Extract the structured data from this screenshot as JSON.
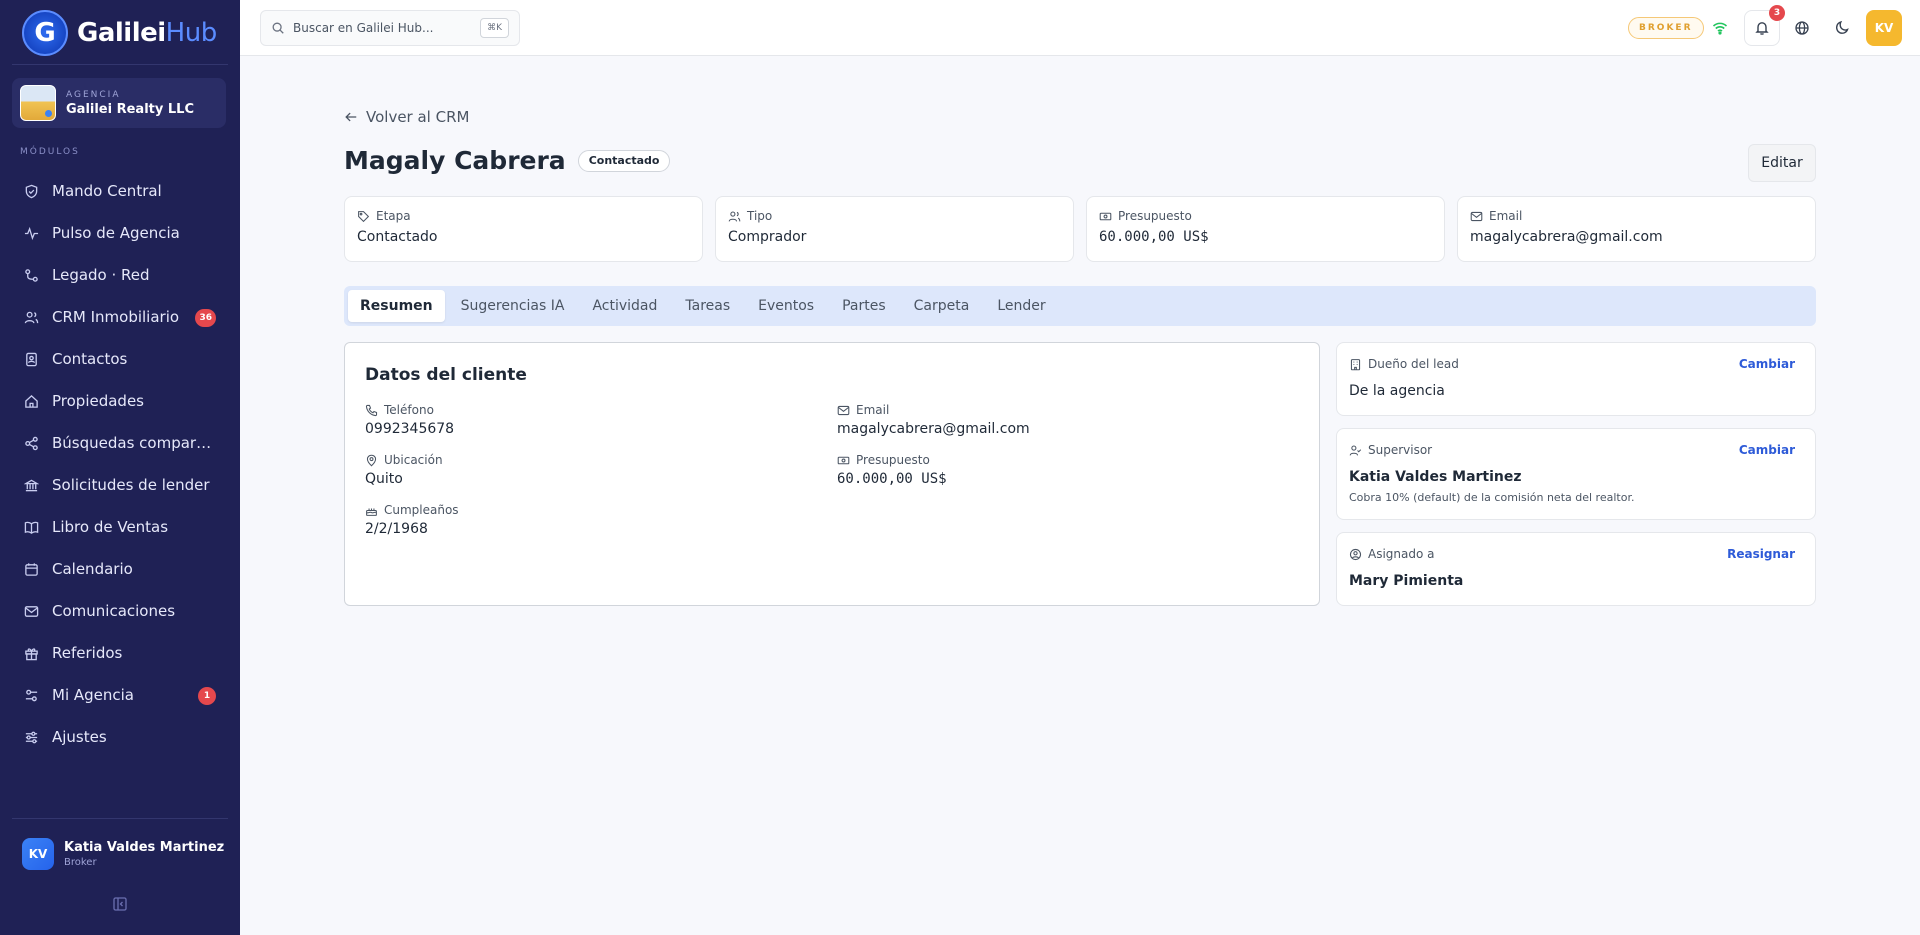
{
  "brand": {
    "name": "Galilei",
    "suffix": "Hub",
    "logo_letter": "G"
  },
  "agency": {
    "kicker": "AGENCIA",
    "name": "Galilei Realty LLC"
  },
  "sidebar": {
    "section_label": "MÓDULOS",
    "items": [
      {
        "label": "Mando Central",
        "icon": "shield-icon"
      },
      {
        "label": "Pulso de Agencia",
        "icon": "pulse-icon"
      },
      {
        "label": "Legado · Red",
        "icon": "network-icon"
      },
      {
        "label": "CRM Inmobiliario",
        "icon": "users-icon",
        "badge": "36"
      },
      {
        "label": "Contactos",
        "icon": "contacts-icon"
      },
      {
        "label": "Propiedades",
        "icon": "home-icon"
      },
      {
        "label": "Búsquedas compartidas",
        "icon": "share-icon"
      },
      {
        "label": "Solicitudes de lender",
        "icon": "bank-icon"
      },
      {
        "label": "Libro de Ventas",
        "icon": "book-icon"
      },
      {
        "label": "Calendario",
        "icon": "calendar-icon"
      },
      {
        "label": "Comunicaciones",
        "icon": "mail-icon"
      },
      {
        "label": "Referidos",
        "icon": "gift-icon"
      },
      {
        "label": "Mi Agencia",
        "icon": "settings-sliders-icon",
        "badge": "1"
      },
      {
        "label": "Ajustes",
        "icon": "sliders-icon"
      }
    ]
  },
  "user": {
    "initials": "KV",
    "name": "Katia Valdes Martinez",
    "role": "Broker"
  },
  "topbar": {
    "search_placeholder": "Buscar en Galilei Hub...",
    "search_shortcut": "⌘K",
    "role_pill": "BROKER",
    "notifications_count": "3",
    "avatar_initials": "KV"
  },
  "page": {
    "back_label": "Volver al CRM",
    "title": "Magaly Cabrera",
    "status": "Contactado",
    "edit_label": "Editar"
  },
  "stats": [
    {
      "label": "Etapa",
      "value": "Contactado",
      "icon": "tag-icon"
    },
    {
      "label": "Tipo",
      "value": "Comprador",
      "icon": "users-icon"
    },
    {
      "label": "Presupuesto",
      "value": "60.000,00 US$",
      "icon": "banknote-icon"
    },
    {
      "label": "Email",
      "value": "magalycabrera@gmail.com",
      "icon": "mail-icon"
    }
  ],
  "tabs": [
    "Resumen",
    "Sugerencias IA",
    "Actividad",
    "Tareas",
    "Eventos",
    "Partes",
    "Carpeta",
    "Lender"
  ],
  "client": {
    "title": "Datos del cliente",
    "phone_label": "Teléfono",
    "phone": "0992345678",
    "email_label": "Email",
    "email": "magalycabrera@gmail.com",
    "location_label": "Ubicación",
    "location": "Quito",
    "budget_label": "Presupuesto",
    "budget": "60.000,00 US$",
    "birthday_label": "Cumpleaños",
    "birthday": "2/2/1968"
  },
  "owner": {
    "label": "Dueño del lead",
    "action": "Cambiar",
    "value": "De la agencia"
  },
  "supervisor": {
    "label": "Supervisor",
    "action": "Cambiar",
    "value": "Katia Valdes Martinez",
    "note": "Cobra 10% (default) de la comisión neta del realtor."
  },
  "assigned": {
    "label": "Asignado a",
    "action": "Reasignar",
    "value": "Mary Pimienta"
  },
  "colors": {
    "sidebar_bg": "#1f2155",
    "accent": "#2e5bd8",
    "badge": "#e5484d",
    "broker": "#e0a030"
  }
}
